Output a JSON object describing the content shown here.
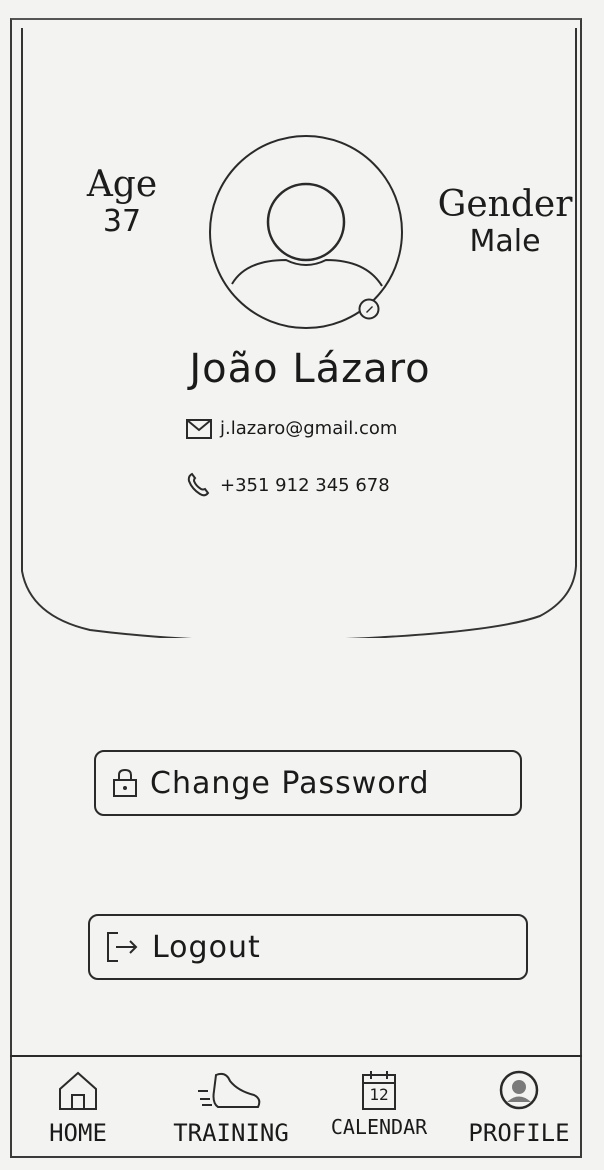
{
  "profile": {
    "age_label": "Age",
    "age_value": "37",
    "gender_label": "Gender",
    "gender_value": "Male",
    "name": "João Lázaro",
    "email": "j.lazaro@gmail.com",
    "phone": "+351 912 345 678"
  },
  "actions": {
    "change_password_label": "Change Password",
    "logout_label": "Logout"
  },
  "nav": {
    "home_label": "HOME",
    "training_label": "TRAINING",
    "calendar_label": "CALENDAR",
    "calendar_day": "12",
    "profile_label": "PROFILE"
  },
  "icons": {
    "avatar": "user-placeholder-icon",
    "edit": "edit-pencil-icon",
    "email": "envelope-icon",
    "phone": "phone-icon",
    "lock": "lock-icon",
    "logout": "logout-arrow-icon",
    "home": "house-icon",
    "training": "running-shoe-icon",
    "calendar": "calendar-icon",
    "profile": "profile-avatar-icon"
  }
}
